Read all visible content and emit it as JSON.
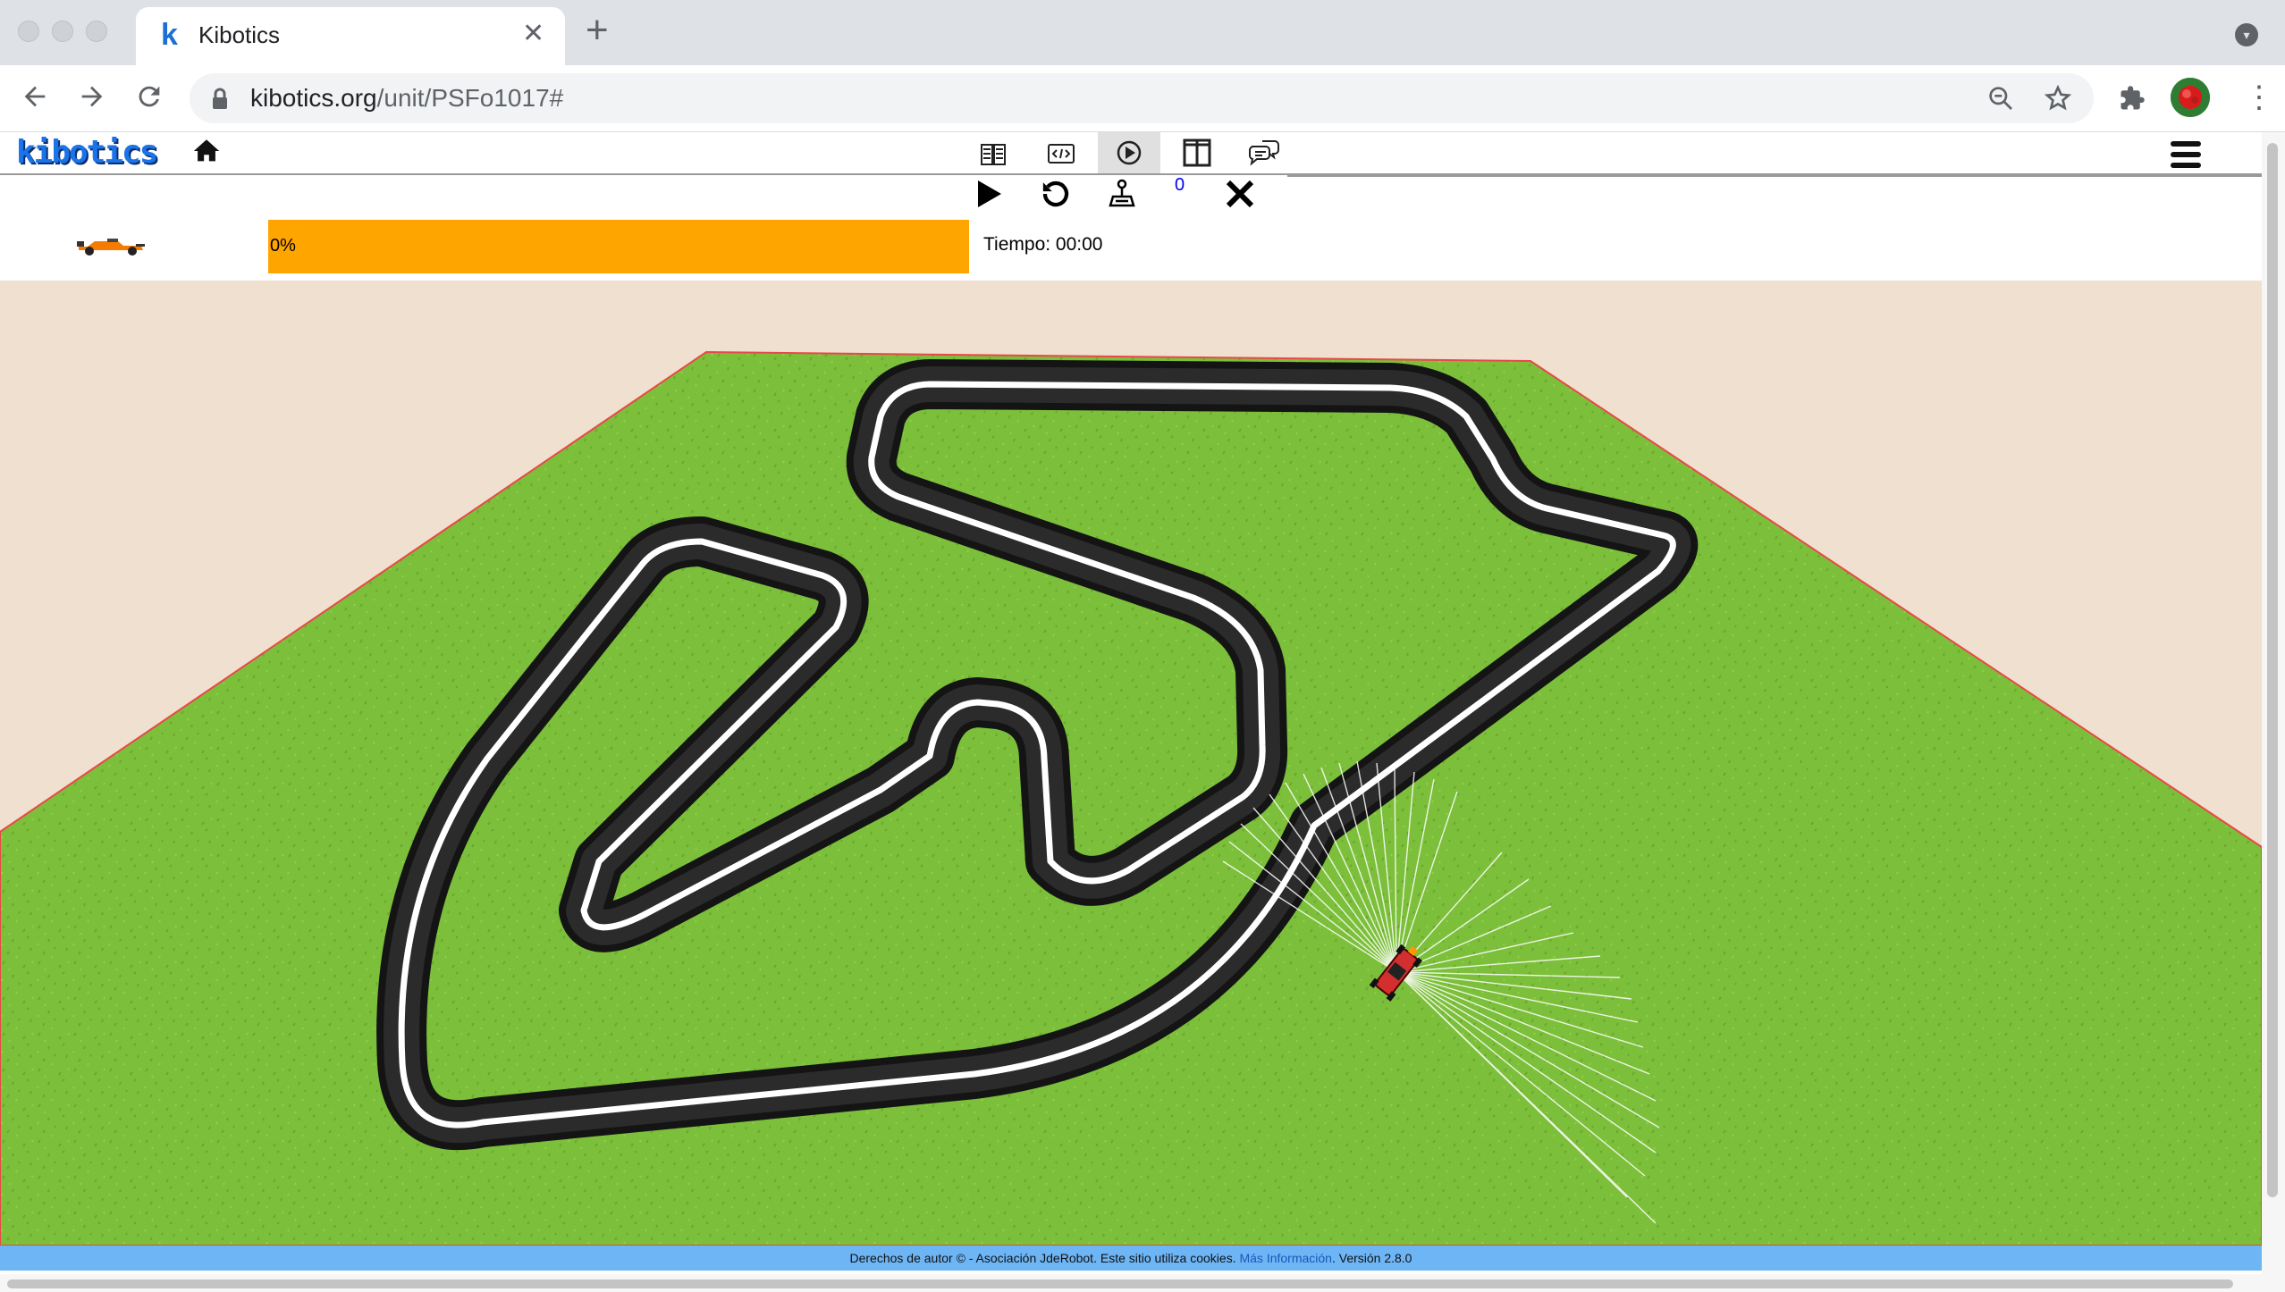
{
  "browser": {
    "tab_title": "Kibotics",
    "tab_favicon": "k",
    "close_tab": "✕",
    "new_tab": "+",
    "url_host": "kibotics.org",
    "url_path": "/unit/PSFo1017#",
    "icons": [
      "back-icon",
      "forward-icon",
      "reload-icon",
      "lock-icon",
      "zoom-icon",
      "star-icon",
      "extensions-icon",
      "menu-icon"
    ]
  },
  "app": {
    "logo": "kibotics",
    "counter": "0",
    "progress": {
      "value": 0,
      "label": "0%"
    },
    "timer": "Tiempo: 00:00",
    "view_buttons": [
      "theory-icon",
      "code-icon",
      "simulation-icon",
      "split-view-icon",
      "chat-icon"
    ],
    "active_view": "simulation-icon",
    "control_buttons": [
      "play-icon",
      "reset-icon",
      "teleop-icon",
      "close-icon"
    ]
  },
  "footer": {
    "text": "Derechos de autor © - Asociación JdeRobot. Este sitio utiliza cookies.",
    "link": "Más Información",
    "version": ". Versión 2.8.0"
  },
  "colors": {
    "progress": "#ffa500",
    "grass": "#7cbf3a",
    "floor": "#f0e0cf",
    "footer": "#6db5f5",
    "track": "#141414"
  }
}
